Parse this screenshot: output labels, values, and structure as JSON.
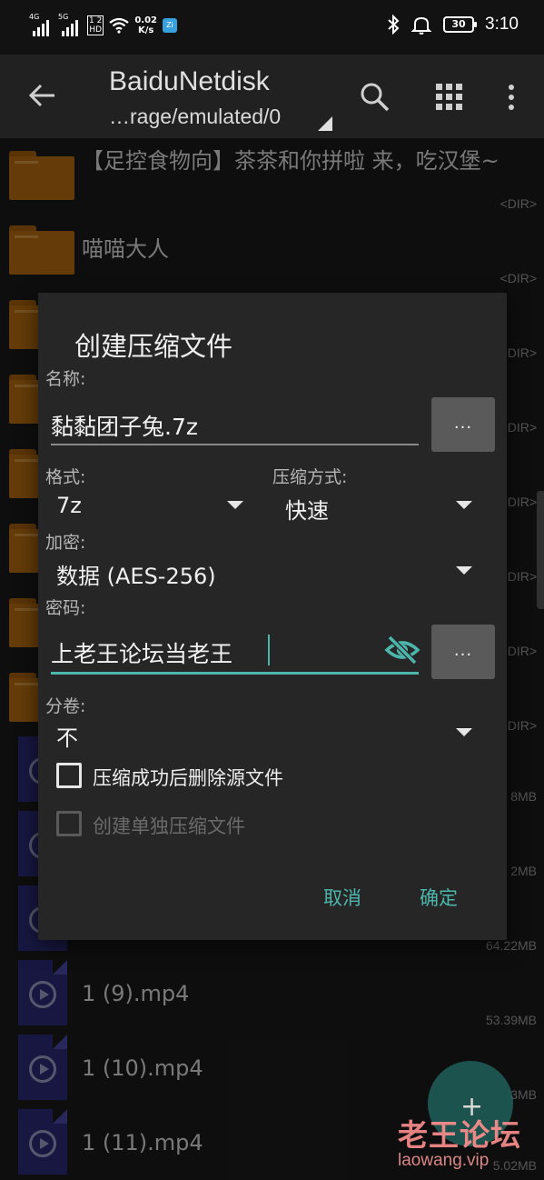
{
  "status_bar": {
    "net1": "4G",
    "net2": "5G",
    "hd": "1 2\nHD",
    "speed_value": "0.02",
    "speed_unit": "K/s",
    "battery": "30",
    "time": "3:10"
  },
  "toolbar": {
    "title": "BaiduNetdisk",
    "path": "…rage/emulated/0"
  },
  "files": [
    {
      "type": "folder",
      "name": "【足控食物向】茶茶和你拼啦 来，吃汉堡~",
      "meta": "<DIR>"
    },
    {
      "type": "folder",
      "name": "喵喵大人",
      "meta": "<DIR>"
    },
    {
      "type": "folder",
      "name": "",
      "meta": "<DIR>"
    },
    {
      "type": "folder",
      "name": "",
      "meta": "<DIR>"
    },
    {
      "type": "folder",
      "name": "",
      "meta": "<DIR>"
    },
    {
      "type": "folder",
      "name": "",
      "meta": "<DIR>"
    },
    {
      "type": "folder",
      "name": "",
      "meta": "<DIR>"
    },
    {
      "type": "folder",
      "name": "",
      "meta": "<DIR>"
    },
    {
      "type": "video",
      "name": "",
      "meta": "8MB"
    },
    {
      "type": "video",
      "name": "",
      "meta": "2MB"
    },
    {
      "type": "video",
      "name": "",
      "meta": "64.22MB"
    },
    {
      "type": "video",
      "name": "1 (9).mp4",
      "meta": "53.39MB"
    },
    {
      "type": "video",
      "name": "1 (10).mp4",
      "meta": "3MB"
    },
    {
      "type": "video",
      "name": "1 (11).mp4",
      "meta": "5.02MB"
    }
  ],
  "dialog": {
    "title": "创建压缩文件",
    "name_label": "名称:",
    "name_value": "黏黏团子兔.7z",
    "browse_label": "...",
    "format_label": "格式:",
    "format_value": "7z",
    "method_label": "压缩方式:",
    "method_value": "快速",
    "encrypt_label": "加密:",
    "encrypt_value": "数据 (AES-256)",
    "password_label": "密码:",
    "password_value": "上老王论坛当老王",
    "volume_label": "分卷:",
    "volume_value": "不",
    "delete_source_label": "压缩成功后删除源文件",
    "delete_source_checked": false,
    "separate_label": "创建单独压缩文件",
    "separate_checked": false,
    "separate_enabled": false,
    "cancel_label": "取消",
    "ok_label": "确定",
    "accent_color": "#4db6ac"
  },
  "fab": {
    "icon": "plus-icon"
  },
  "watermark": {
    "text_cn": "老王论坛",
    "text_en": "laowang.vip"
  }
}
